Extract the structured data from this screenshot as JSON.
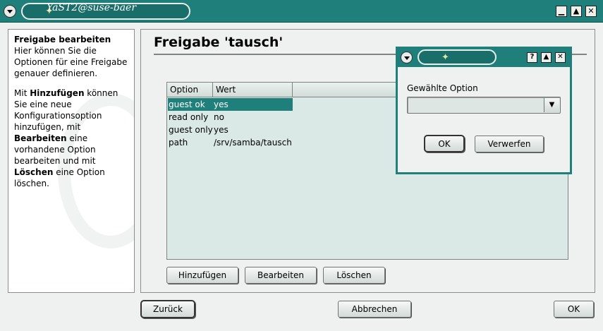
{
  "window": {
    "title": "YaST2@suse-baer",
    "logo_icon": "yast-logo-icon",
    "title_bar_color": "#1f7f7a",
    "minimize_glyph": "▁",
    "maximize_glyph": "▲",
    "close_glyph": "✕"
  },
  "help": {
    "title": "Freigabe bearbeiten",
    "line1": "Hier können Sie die Optionen für eine Freigabe genauer definieren.",
    "p2_pre": "Mit ",
    "p2_add": "Hinzufügen",
    "p2_mid1": " können Sie eine neue Konfigurationsoption hinzufügen, mit ",
    "p2_edit": "Bearbeiten",
    "p2_mid2": " eine vorhandene Option bearbeiten und mit ",
    "p2_delete": "Löschen",
    "p2_end": " eine Option löschen."
  },
  "main": {
    "heading": "Freigabe 'tausch'",
    "table": {
      "headers": [
        "Option",
        "Wert"
      ],
      "rows": [
        {
          "option": "guest ok",
          "value": "yes",
          "selected": true
        },
        {
          "option": "read only",
          "value": "no",
          "selected": false
        },
        {
          "option": "guest only",
          "value": "yes",
          "selected": false
        },
        {
          "option": "path",
          "value": "/srv/samba/tausch",
          "selected": false
        }
      ]
    },
    "buttons": {
      "add": "Hinzufügen",
      "edit": "Bearbeiten",
      "delete": "Löschen"
    }
  },
  "footer": {
    "back": "Zurück",
    "cancel": "Abbrechen",
    "ok": "OK"
  },
  "dialog": {
    "label": "Gewählte Option",
    "combo_value": "",
    "ok": "OK",
    "discard": "Verwerfen",
    "help_glyph": "?",
    "maximize_glyph": "▲",
    "close_glyph": "✕",
    "combo_arrow_glyph": "▼"
  }
}
